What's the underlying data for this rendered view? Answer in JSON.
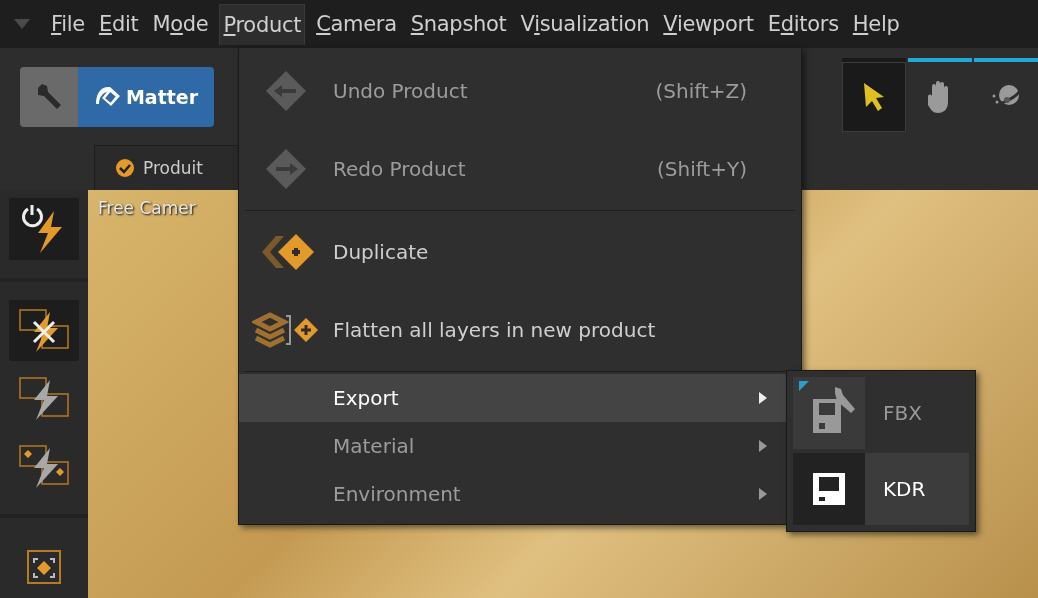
{
  "menubar": [
    {
      "key": "F",
      "post": "ile",
      "open": false
    },
    {
      "key": "E",
      "post": "dit",
      "open": false
    },
    {
      "pre": "M",
      "key": "o",
      "post": "de",
      "open": false
    },
    {
      "key": "P",
      "post": "roduct",
      "open": true
    },
    {
      "key": "C",
      "post": "amera",
      "open": false
    },
    {
      "key": "S",
      "post": "napshot",
      "open": false
    },
    {
      "pre": "V",
      "key": "i",
      "post": "sualization",
      "open": false
    },
    {
      "key": "V",
      "post": "iewport",
      "open": false
    },
    {
      "pre": "E",
      "key": "d",
      "post": "itors",
      "open": false
    },
    {
      "key": "H",
      "post": "elp",
      "open": false
    }
  ],
  "toolbar": {
    "mode_buttons": [
      {
        "kind": "wrench",
        "selected": false
      },
      {
        "kind": "matter",
        "label": "Matter",
        "selected": true
      }
    ],
    "tools": [
      {
        "kind": "arrow",
        "selected": true
      },
      {
        "kind": "hand",
        "selected": false
      },
      {
        "kind": "orbit",
        "selected": false
      }
    ]
  },
  "tab": {
    "label": "Produit",
    "checked": true
  },
  "viewport": {
    "label": "Free Camer"
  },
  "sidebar": [
    {
      "kind": "power",
      "selected": true
    },
    {
      "kind": "cancel",
      "selected": true
    },
    {
      "kind": "bolt",
      "selected": false
    },
    {
      "kind": "bolt-dots",
      "selected": false
    },
    {
      "kind": "frame",
      "selected": false
    }
  ],
  "menu": [
    {
      "kind": "undo",
      "label": "Undo Product",
      "shortcut": "(Shift+Z)",
      "disabled": true,
      "highlighted": false
    },
    {
      "kind": "redo",
      "label": "Redo Product",
      "shortcut": "(Shift+Y)",
      "disabled": true,
      "highlighted": false
    },
    {
      "kind": "separator"
    },
    {
      "kind": "duplicate",
      "label": "Duplicate",
      "disabled": false,
      "highlighted": false
    },
    {
      "kind": "flatten",
      "label": "Flatten all layers in new product",
      "disabled": false,
      "highlighted": false
    },
    {
      "kind": "separator"
    },
    {
      "kind": "submenu",
      "label": "Export",
      "disabled": false,
      "highlighted": true
    },
    {
      "kind": "submenu",
      "label": "Material",
      "disabled": true,
      "highlighted": false
    },
    {
      "kind": "submenu",
      "label": "Environment",
      "disabled": true,
      "highlighted": false
    }
  ],
  "submenu": [
    {
      "kind": "configurable",
      "label": "FBX",
      "highlighted": false
    },
    {
      "kind": "plain",
      "label": "KDR",
      "highlighted": true
    }
  ]
}
